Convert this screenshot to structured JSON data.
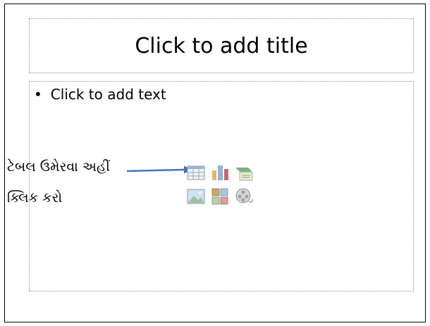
{
  "slide": {
    "title_placeholder": "Click to add title",
    "body_bullet_symbol": "•",
    "body_placeholder": "Click to add text"
  },
  "annotation": {
    "line1": "ટેબલ ઉમેરવા અહીં",
    "line2": "ક્લિક કરો",
    "arrow_color": "#4472c4"
  },
  "content_icons": [
    {
      "name": "insert-table-icon"
    },
    {
      "name": "insert-chart-icon"
    },
    {
      "name": "insert-smartart-icon"
    },
    {
      "name": "insert-picture-icon"
    },
    {
      "name": "insert-clipart-icon"
    },
    {
      "name": "insert-media-icon"
    }
  ]
}
